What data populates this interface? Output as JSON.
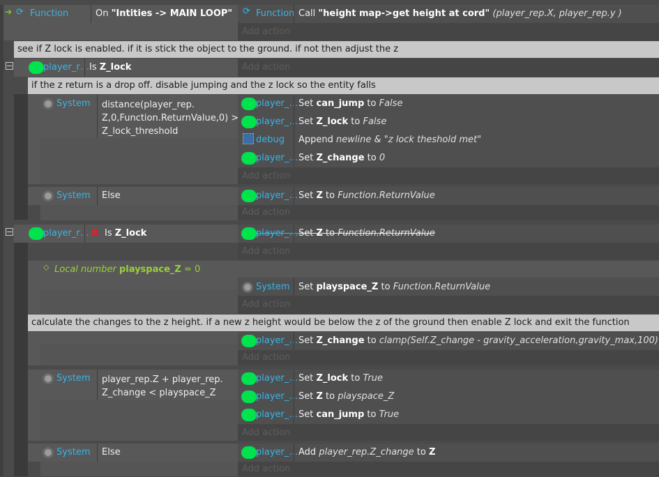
{
  "colors": {
    "accent": "#3bb4e6",
    "sprite": "#00e34d",
    "local_var": "#9bd13a",
    "invert": "#e0202a"
  },
  "header": {
    "function_label": "Function",
    "on_text": "On ",
    "on_value": "\"Intities -> MAIN LOOP\"",
    "action_obj": "Function",
    "call_text": "Call ",
    "call_name": "\"height map->get height at cord\"",
    "call_args": " (player_rep.X, player_rep.y )"
  },
  "add_action": "Add action",
  "comments": [
    "see if Z lock is enabled. if it is stick the object to the ground. if not then adjust the z",
    "if the z return is a drop off. disable jumping and the z lock so the entity falls",
    "calculate the changes to the z height. if a new z height would be below the z of the ground then enable Z lock and exit the function"
  ],
  "objects": {
    "player": "player_…",
    "player_r": "player_r…",
    "system": "System",
    "debug": "debug"
  },
  "block1": {
    "cond_prefix": "Is ",
    "cond_bold": "Z_lock"
  },
  "block1a": {
    "cond_line1": "distance(player_rep.",
    "cond_line2": "Z,0,Function.ReturnValue,0) >",
    "cond_line3": "Z_lock_threshold"
  },
  "actions": {
    "a1": {
      "pre": "Set ",
      "bold": "can_jump",
      "mid": " to ",
      "val": "False"
    },
    "a2": {
      "pre": "Set ",
      "bold": "Z_lock",
      "mid": " to ",
      "val": "False"
    },
    "a3": {
      "pre": "Append ",
      "val": "newline & \"z lock theshold met\""
    },
    "a4": {
      "pre": "Set ",
      "bold": "Z_change",
      "mid": " to ",
      "val": "0"
    },
    "a5": {
      "pre": "Set ",
      "bold": "Z",
      "mid": " to ",
      "val": "Function.ReturnValue"
    },
    "a6": {
      "pre": "Set ",
      "bold": "Z",
      "mid": " to ",
      "val": "Function.ReturnValue"
    },
    "a7": {
      "pre": "Set ",
      "bold": "playspace_Z",
      "mid": " to ",
      "val": "Function.ReturnValue"
    },
    "a8": {
      "pre": "Set ",
      "bold": "Z_change",
      "mid": " to ",
      "val": "clamp(Self.Z_change - gravity_acceleration,gravity_max,100)"
    },
    "a9": {
      "pre": "Set ",
      "bold": "Z_lock",
      "mid": " to ",
      "val": "True"
    },
    "a10": {
      "pre": "Set ",
      "bold": "Z",
      "mid": " to ",
      "val": "playspace_Z"
    },
    "a11": {
      "pre": "Set ",
      "bold": "can_jump",
      "mid": " to ",
      "val": "True"
    },
    "a12": {
      "pre": "Add ",
      "val": "player_rep.Z_change",
      "mid": "  to ",
      "bold": "Z"
    }
  },
  "else_label": "Else",
  "block2": {
    "cond_prefix": "Is ",
    "cond_bold": "Z_lock"
  },
  "local_var": {
    "label": "Local number ",
    "name": "playspace_Z",
    "eq": " = 0"
  },
  "block3": {
    "line1": "player_rep.Z + player_rep.",
    "line2": "Z_change < playspace_Z"
  }
}
